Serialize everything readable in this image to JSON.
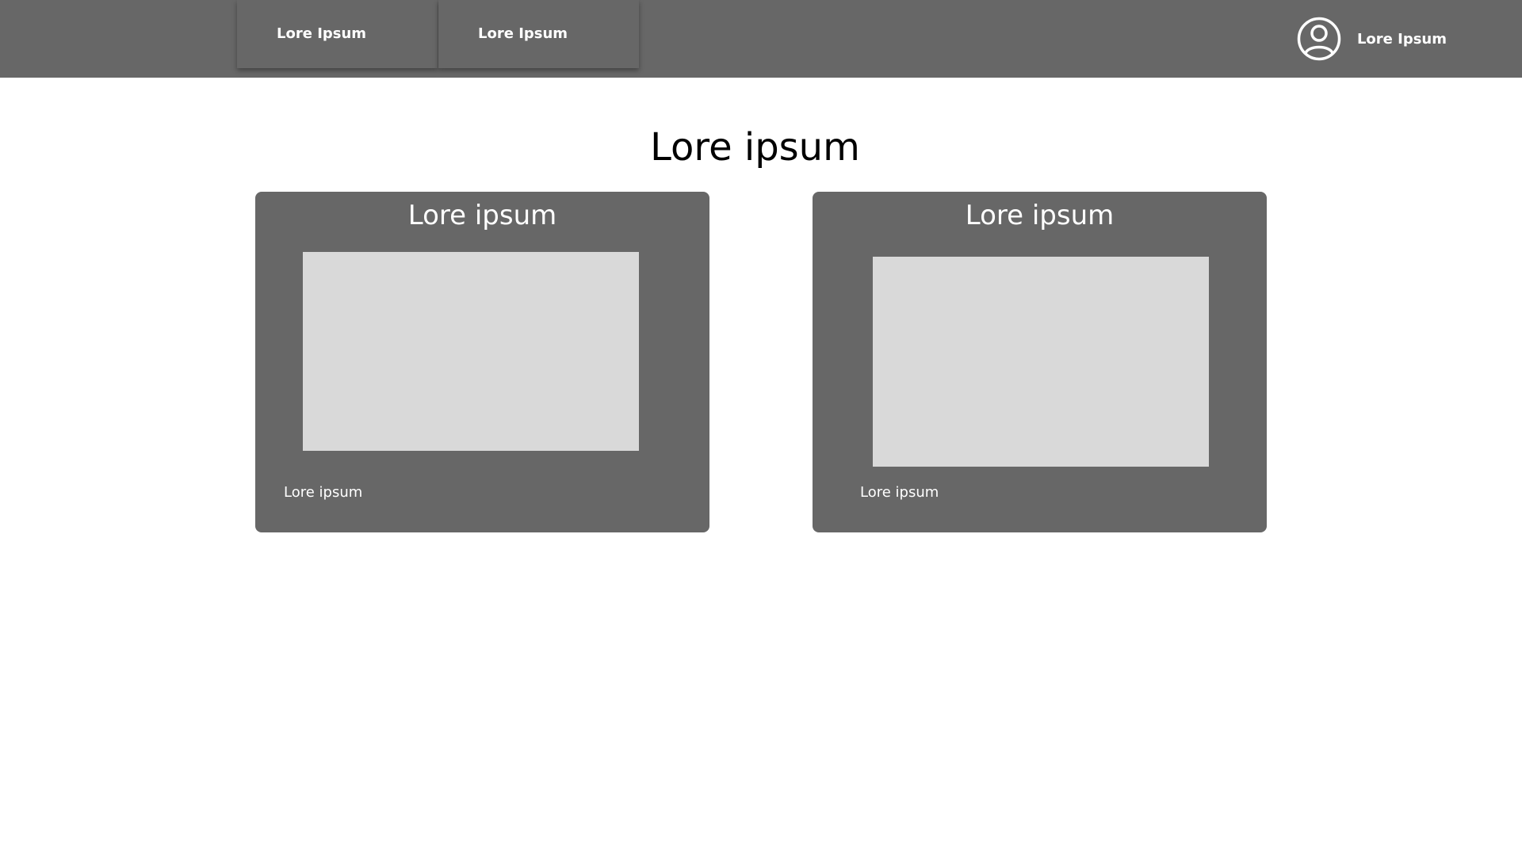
{
  "header": {
    "nav_tabs": [
      {
        "label": "Lore Ipsum"
      },
      {
        "label": "Lore Ipsum"
      }
    ],
    "user": {
      "icon": "user-circle-icon",
      "name": "Lore Ipsum"
    }
  },
  "main": {
    "title": "Lore ipsum",
    "cards": [
      {
        "title": "Lore ipsum",
        "caption": "Lore ipsum"
      },
      {
        "title": "Lore ipsum",
        "caption": "Lore ipsum"
      }
    ]
  },
  "colors": {
    "bar": "#676767",
    "card": "#676767",
    "placeholder": "#d9d9d9",
    "text_light": "#ffffff",
    "text_dark": "#000000"
  }
}
